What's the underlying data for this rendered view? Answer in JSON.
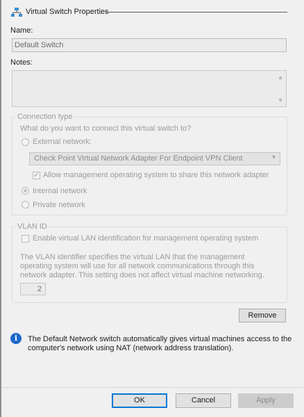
{
  "header": {
    "title": "Virtual Switch Properties",
    "icon": "network-switch-icon"
  },
  "name": {
    "label": "Name:",
    "value": "Default Switch"
  },
  "notes": {
    "label": "Notes:",
    "value": ""
  },
  "connection": {
    "legend": "Connection type",
    "question": "What do you want to connect this virtual switch to?",
    "external_label": "External network:",
    "adapter_value": "Check Point Virtual Network Adapter For Endpoint VPN Client",
    "allow_mgmt_label": "Allow management operating system to share this network adapter",
    "internal_label": "Internal network",
    "private_label": "Private network",
    "selected": "internal"
  },
  "vlan": {
    "legend": "VLAN ID",
    "enable_label": "Enable virtual LAN identification for management operating system",
    "description": "The VLAN identifier specifies the virtual LAN that the management operating system will use for all network communications through this network adapter. This setting does not affect virtual machine networking.",
    "value": "2"
  },
  "remove_label": "Remove",
  "info": {
    "text": "The Default Network switch automatically gives virtual machines access to the computer's network using NAT (network address translation)."
  },
  "footer": {
    "ok_label": "OK",
    "cancel_label": "Cancel",
    "apply_label": "Apply"
  },
  "colors": {
    "accent": "#0078d7",
    "info_icon": "#1b6ac9",
    "panel_bg": "#f0f0f0"
  }
}
